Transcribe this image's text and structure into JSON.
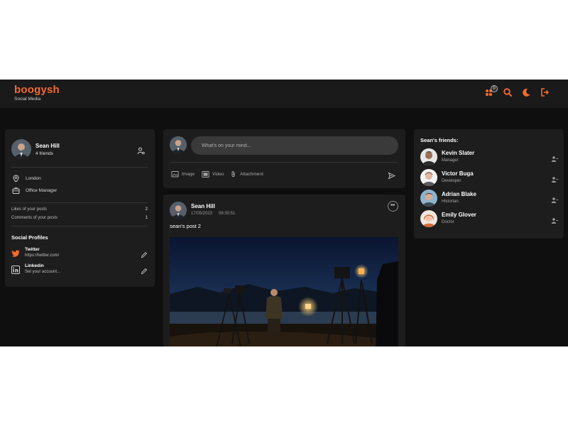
{
  "header": {
    "logo": "boogysh",
    "tagline": "Social Media",
    "notification_count": "0",
    "accent_color": "#f26a2e",
    "icons": [
      "friend-requests-icon",
      "search-icon",
      "moon-icon",
      "logout-icon"
    ]
  },
  "profile": {
    "name": "Sean Hill",
    "friends_count": "4 friends",
    "location": "London",
    "occupation": "Office Manager",
    "stats": [
      {
        "label": "Likes of your posts",
        "value": "2"
      },
      {
        "label": "Comments of your posts",
        "value": "1"
      }
    ],
    "social_title": "Social Profiles",
    "socials": [
      {
        "name": "Twitter",
        "value": "https://twitter.com/",
        "icon": "twitter-icon"
      },
      {
        "name": "Linkedin",
        "value": "Set your account...",
        "icon": "linkedin-icon"
      }
    ]
  },
  "composer": {
    "placeholder": "What's on your mind...",
    "actions": [
      {
        "label": "Image",
        "icon": "image-icon"
      },
      {
        "label": "Video",
        "icon": "video-icon"
      },
      {
        "label": "Attachment",
        "icon": "paperclip-icon"
      }
    ]
  },
  "post": {
    "author": "Sean Hill",
    "date": "17/05/2023",
    "time": "08:30:51",
    "text": "sean's post 2"
  },
  "friends_panel": {
    "title": "Sean's friends:",
    "friends": [
      {
        "name": "Kevin Slater",
        "role": "Manager"
      },
      {
        "name": "Victor Buga",
        "role": "Developer"
      },
      {
        "name": "Adrian Blake",
        "role": "Historian"
      },
      {
        "name": "Emily Glover",
        "role": "Doctor"
      }
    ]
  }
}
